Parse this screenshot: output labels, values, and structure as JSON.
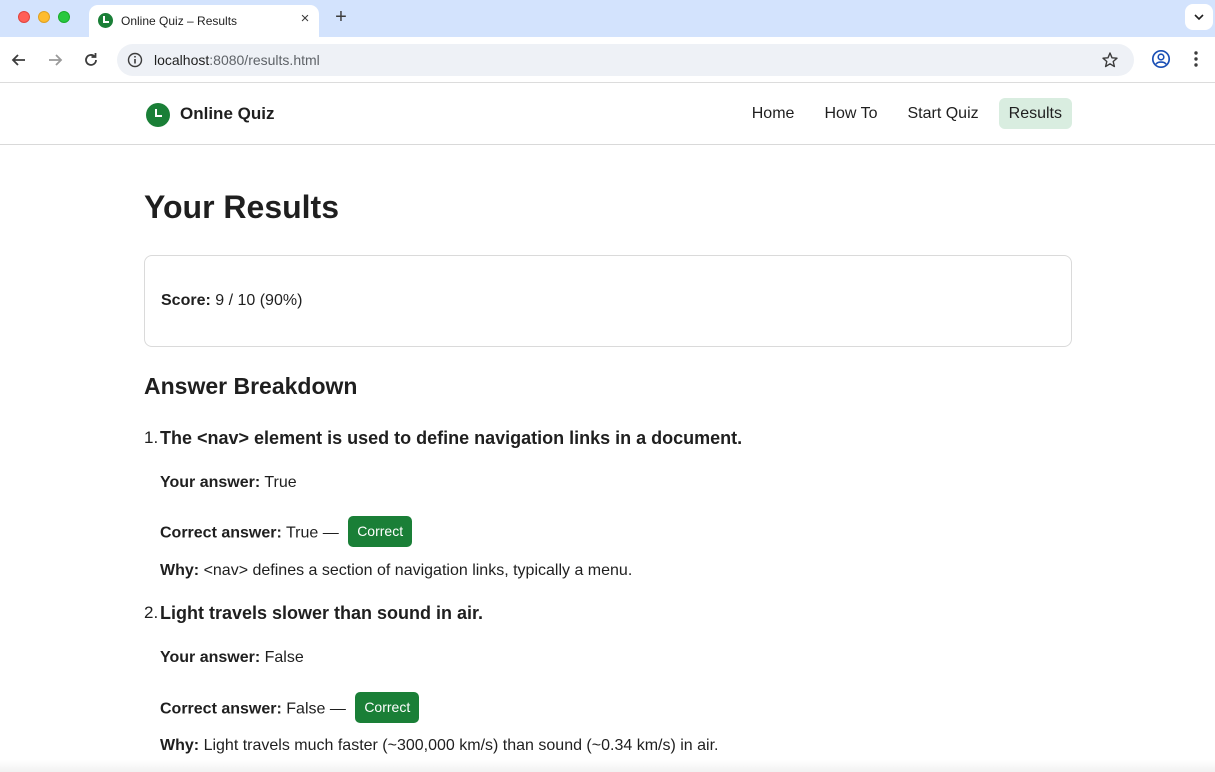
{
  "browser": {
    "tab_title": "Online Quiz – Results",
    "tab_close": "×",
    "new_tab": "+",
    "url_host": "localhost",
    "url_rest": ":8080/results.html"
  },
  "site": {
    "brand": "Online Quiz",
    "nav": [
      {
        "label": "Home",
        "active": false
      },
      {
        "label": "How To",
        "active": false
      },
      {
        "label": "Start Quiz",
        "active": false
      },
      {
        "label": "Results",
        "active": true
      }
    ]
  },
  "results": {
    "title": "Your Results",
    "score_label": "Score:",
    "score_value": "9 / 10 (90%)",
    "breakdown_title": "Answer Breakdown",
    "your_answer_label": "Your answer:",
    "correct_answer_label": "Correct answer:",
    "why_label": "Why:",
    "questions": [
      {
        "number": "1.",
        "text": "The <nav> element is used to define navigation links in a document.",
        "your_answer": "True",
        "correct_answer": "True —",
        "badge": "Correct",
        "why": "<nav> defines a section of navigation links, typically a menu."
      },
      {
        "number": "2.",
        "text": "Light travels slower than sound in air.",
        "your_answer": "False",
        "correct_answer": "False —",
        "badge": "Correct",
        "why": "Light travels much faster (~300,000 km/s) than sound (~0.34 km/s) in air."
      }
    ]
  },
  "colors": {
    "accent": "#1a7f37",
    "nav_active_bg": "#d9ede0",
    "tabbar_bg": "#d3e3fd"
  }
}
